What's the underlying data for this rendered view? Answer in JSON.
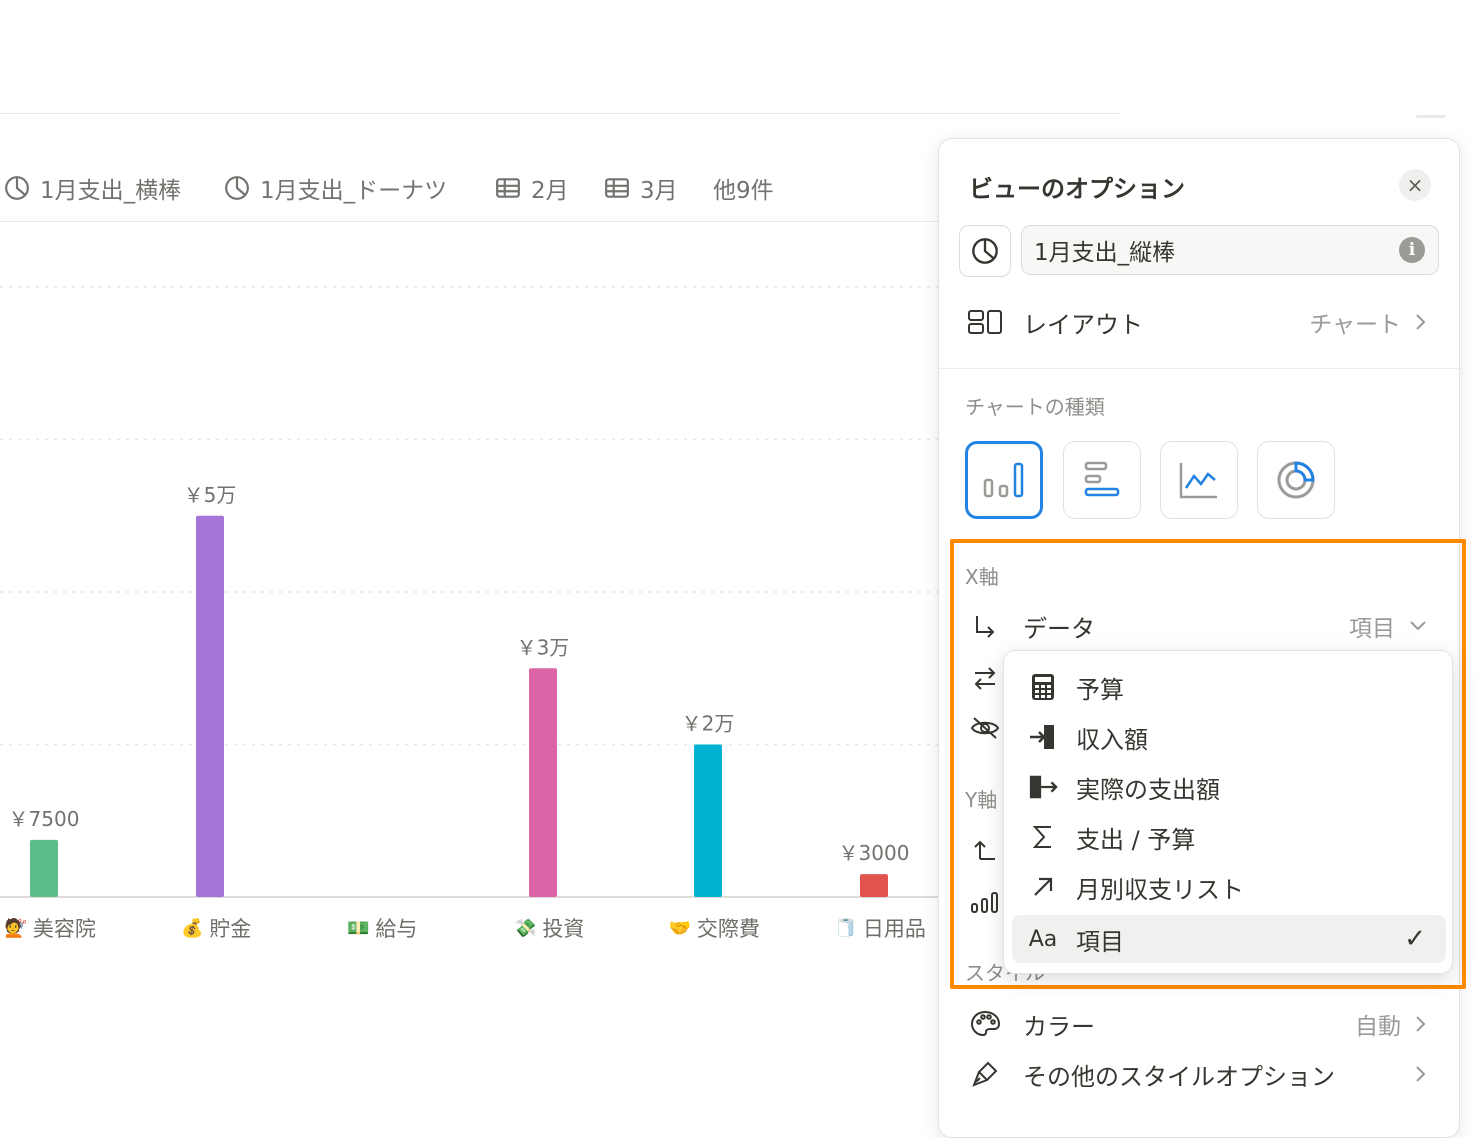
{
  "tabs": [
    {
      "label": "1月支出_横棒",
      "icon": "pie-chart-icon"
    },
    {
      "label": "1月支出_ドーナツ",
      "icon": "pie-chart-icon"
    },
    {
      "label": "2月",
      "icon": "table-icon"
    },
    {
      "label": "3月",
      "icon": "table-icon"
    },
    {
      "label": "他9件"
    }
  ],
  "chart_data": {
    "type": "bar",
    "categories": [
      "美容院",
      "貯金",
      "給与",
      "投資",
      "交際費",
      "日用品"
    ],
    "category_emoji": [
      "💇",
      "💰",
      "💵",
      "💸",
      "🤝",
      "🧻"
    ],
    "values": [
      7500,
      50000,
      0,
      30000,
      20000,
      3000
    ],
    "data_labels": [
      "￥7500",
      "￥5万",
      "",
      "￥3万",
      "￥2万",
      "￥3000"
    ],
    "colors": [
      "#5bbd8a",
      "#a576d8",
      "#cccccc",
      "#dc63a5",
      "#00b2d2",
      "#e0534f"
    ],
    "ylim": [
      0,
      80000
    ],
    "grid": true,
    "legend": "none"
  },
  "panel": {
    "title": "ビューのオプション",
    "close_label": "×",
    "view_name": "1月支出_縦棒",
    "info_label": "i",
    "layout_label": "レイアウト",
    "layout_value": "チャート",
    "chart_type_section": "チャートの種類",
    "chart_types": [
      {
        "name": "vertical-bar",
        "selected": true
      },
      {
        "name": "horizontal-bar",
        "selected": false
      },
      {
        "name": "line",
        "selected": false
      },
      {
        "name": "donut",
        "selected": false
      }
    ],
    "x_axis_section": "X軸",
    "x_data_label": "データ",
    "x_data_value": "項目",
    "y_axis_section": "Y軸",
    "style_section": "スタイル",
    "color_label": "カラー",
    "color_value": "自動",
    "more_style_label": "その他のスタイルオプション"
  },
  "dropdown": {
    "options": [
      {
        "label": "予算",
        "icon": "calculator-icon"
      },
      {
        "label": "収入額",
        "icon": "login-icon"
      },
      {
        "label": "実際の支出額",
        "icon": "logout-icon"
      },
      {
        "label": "支出 / 予算",
        "icon": "sigma-icon"
      },
      {
        "label": "月別収支リスト",
        "icon": "relation-arrow-icon"
      },
      {
        "label": "項目",
        "icon": "text-aa-icon",
        "selected": true
      }
    ],
    "text_icon_label": "Aa",
    "check": "✓"
  },
  "accent": "#2383e2",
  "highlight_color": "#ff8a00"
}
